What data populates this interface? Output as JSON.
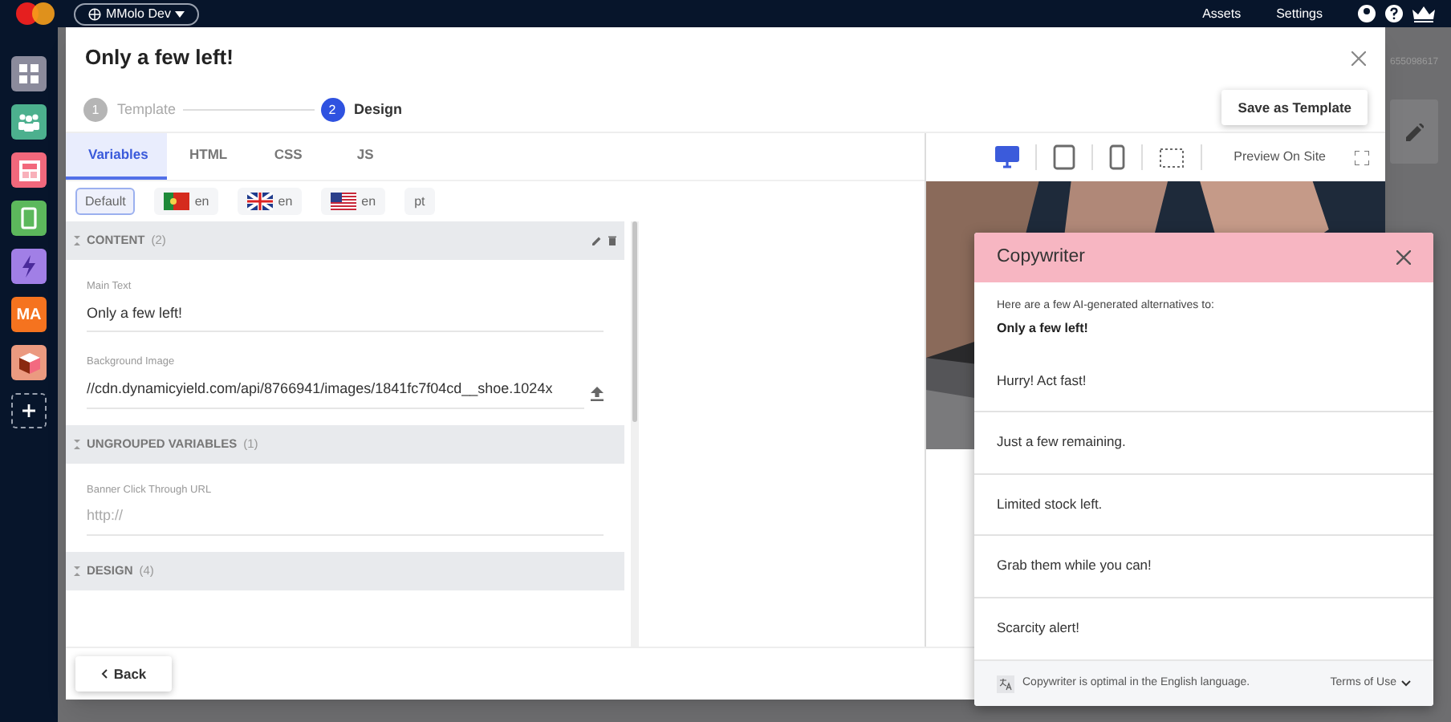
{
  "top_bar": {
    "workspace": "MMolo Dev",
    "nav": [
      "Assets",
      "Settings"
    ]
  },
  "sidebar": [
    {
      "kind": "grid",
      "color": "#8b8b9c"
    },
    {
      "kind": "people",
      "color": "#4cb08e"
    },
    {
      "kind": "layout",
      "color": "#f2687c"
    },
    {
      "kind": "phone",
      "color": "#5cb85c"
    },
    {
      "kind": "bolt",
      "color": "#a17fe6"
    },
    {
      "kind": "text",
      "color": "#f5731f",
      "label": "MA"
    },
    {
      "kind": "box",
      "color": "#eb9a80"
    },
    {
      "kind": "add"
    }
  ],
  "page_id": "655098617",
  "dialog": {
    "title": "Only a few left!",
    "steps": [
      {
        "number": "1",
        "label": "Template",
        "selected": false
      },
      {
        "number": "2",
        "label": "Design",
        "selected": true
      }
    ],
    "save_button": "Save as Template",
    "tabs": [
      {
        "label": "Variables",
        "selected": true
      },
      {
        "label": "HTML",
        "selected": false
      },
      {
        "label": "CSS",
        "selected": false
      },
      {
        "label": "JS",
        "selected": false
      }
    ],
    "languages": [
      {
        "label": "Default",
        "kind": "plain",
        "selected": true
      },
      {
        "label": "en",
        "kind": "portugal",
        "selected": false
      },
      {
        "label": "en",
        "kind": "uk",
        "selected": false
      },
      {
        "label": "en",
        "kind": "usa",
        "selected": false
      },
      {
        "label": "pt",
        "kind": "plain",
        "selected": false
      }
    ],
    "sections": [
      {
        "title": "CONTENT",
        "count": "(2)",
        "actions": true,
        "fields": [
          {
            "label": "Main Text",
            "value": "Only a few left!",
            "upload": false
          },
          {
            "label": "Background Image",
            "value": "//cdn.dynamicyield.com/api/8766941/images/1841fc7f04cd__shoe.1024x",
            "upload": true
          }
        ]
      },
      {
        "title": "UNGROUPED VARIABLES",
        "count": "(1)",
        "actions": false,
        "fields": [
          {
            "label": "Banner Click Through URL",
            "placeholder": "http://",
            "upload": false
          }
        ]
      },
      {
        "title": "DESIGN",
        "count": "(4)",
        "actions": false
      }
    ],
    "devices": [
      {
        "kind": "desktop",
        "selected": true
      },
      {
        "kind": "tablet",
        "selected": false
      },
      {
        "kind": "mobile",
        "selected": false
      },
      {
        "kind": "custom",
        "selected": false
      }
    ],
    "preview_on_site": "Preview On Site",
    "back_button": "Back"
  },
  "copywriter": {
    "title": "Copywriter",
    "intro": "Here are a few AI-generated alternatives to:",
    "original": "Only a few left!",
    "alternatives": [
      "Hurry! Act fast!",
      "Just a few remaining.",
      "Limited stock left.",
      "Grab them while you can!",
      "Scarcity alert!"
    ],
    "footer_note": "Copywriter is optimal in the English language.",
    "terms": "Terms of Use"
  }
}
